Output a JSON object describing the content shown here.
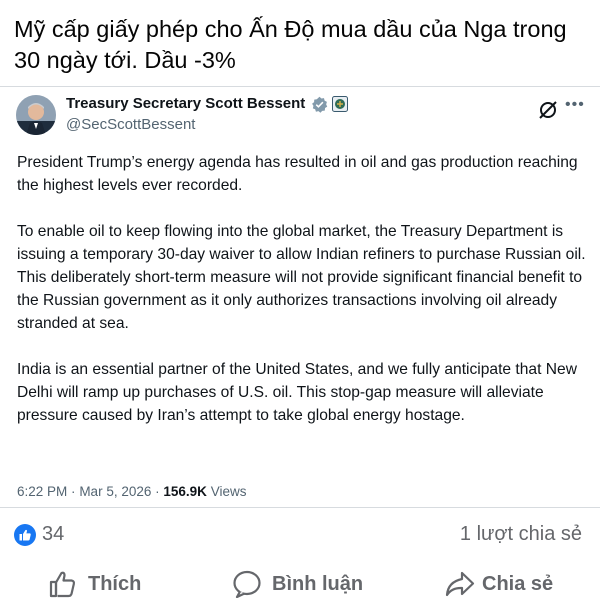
{
  "headline": "Mỹ cấp giấy phép cho Ấn Độ mua dầu của Nga trong 30 ngày tới. Dầu -3%",
  "tweet": {
    "author_name": "Treasury Secretary Scott Bessent",
    "handle": "@SecScottBessent",
    "paragraphs": [
      "President Trump’s energy agenda has resulted in oil and gas production reaching the highest levels ever recorded.",
      "To enable oil to keep flowing into the global market, the Treasury Department is issuing a temporary 30-day waiver to allow Indian refiners to purchase Russian oil. This deliberately short-term measure will not provide significant financial benefit to the Russian government as it only authorizes transactions involving oil already stranded at sea.",
      "India is an essential partner of the United States, and we fully anticipate that New Delhi will ramp up purchases of U.S. oil. This stop-gap measure will alleviate pressure caused by Iran’s attempt to take global energy hostage."
    ],
    "time": "6:22 PM",
    "separator": "·",
    "date": "Mar 5, 2026",
    "views_count": "156.9K",
    "views_label": "Views"
  },
  "reactions": {
    "like_count": "34",
    "share_count": "1 lượt chia sẻ"
  },
  "actions": {
    "like_label": "Thích",
    "comment_label": "Bình luận",
    "share_label": "Chia sẻ"
  },
  "colors": {
    "like_badge": "#1877f2",
    "verified_badge": "#829aab",
    "text_secondary": "#65676b"
  },
  "icons": [
    "verified-badge-icon",
    "treasury-seal-icon",
    "grok-icon",
    "more-options-icon",
    "like-badge-icon",
    "thumbs-up-icon",
    "comment-icon",
    "share-icon"
  ]
}
